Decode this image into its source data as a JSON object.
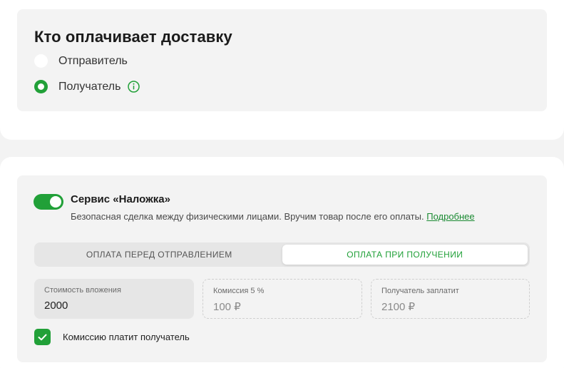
{
  "delivery_payer": {
    "title": "Кто оплачивает доставку",
    "options": [
      {
        "label": "Отправитель",
        "selected": false
      },
      {
        "label": "Получатель",
        "selected": true
      }
    ],
    "info_icon": "info-circle-icon"
  },
  "service": {
    "enabled": true,
    "title": "Сервис «Наложка»",
    "description": "Безопасная сделка между физическими лицами. Вручим товар после его оплаты.",
    "link_label": "Подробнее",
    "tabs": [
      {
        "label": "ОПЛАТА ПЕРЕД ОТПРАВЛЕНИЕМ",
        "active": false
      },
      {
        "label": "ОПЛАТА ПРИ ПОЛУЧЕНИИ",
        "active": true
      }
    ],
    "fields": {
      "value": {
        "label": "Стоимость вложения",
        "value": "2000"
      },
      "commission": {
        "label": "Комиссия 5 %",
        "value": "100 ₽"
      },
      "recipient_pays": {
        "label": "Получатель заплатит",
        "value": "2100 ₽"
      }
    },
    "commission_checkbox": {
      "label": "Комиссию платит получатель",
      "checked": true
    }
  },
  "colors": {
    "accent": "#21a038",
    "link": "#1a8a32",
    "panel_bg": "#f3f3f3"
  }
}
